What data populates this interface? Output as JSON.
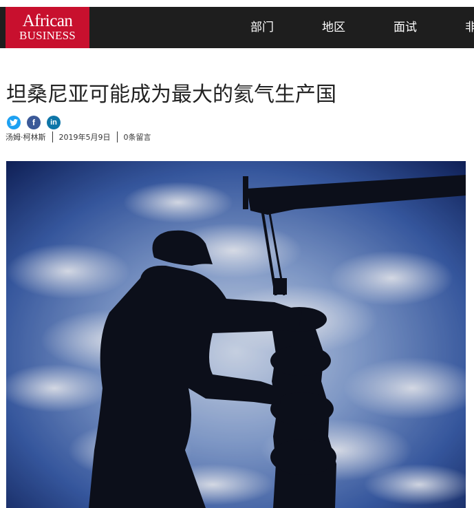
{
  "header": {
    "logo_line1": "African",
    "logo_line2": "BUSINESS",
    "nav": [
      {
        "label": "部门"
      },
      {
        "label": "地区"
      },
      {
        "label": "面试"
      },
      {
        "label": "非"
      }
    ]
  },
  "article": {
    "title": "坦桑尼亚可能成为最大的氦气生产国",
    "share_icons": [
      "twitter-icon",
      "facebook-icon",
      "linkedin-icon"
    ],
    "author": "汤姆·柯林斯",
    "date": "2019年5月9日",
    "comments": "0条留言"
  },
  "colors": {
    "navbar_bg": "#1e1e1e",
    "logo_bg": "#c8102e",
    "twitter": "#1da1f2",
    "facebook": "#3b5998",
    "linkedin": "#0e76a8"
  }
}
